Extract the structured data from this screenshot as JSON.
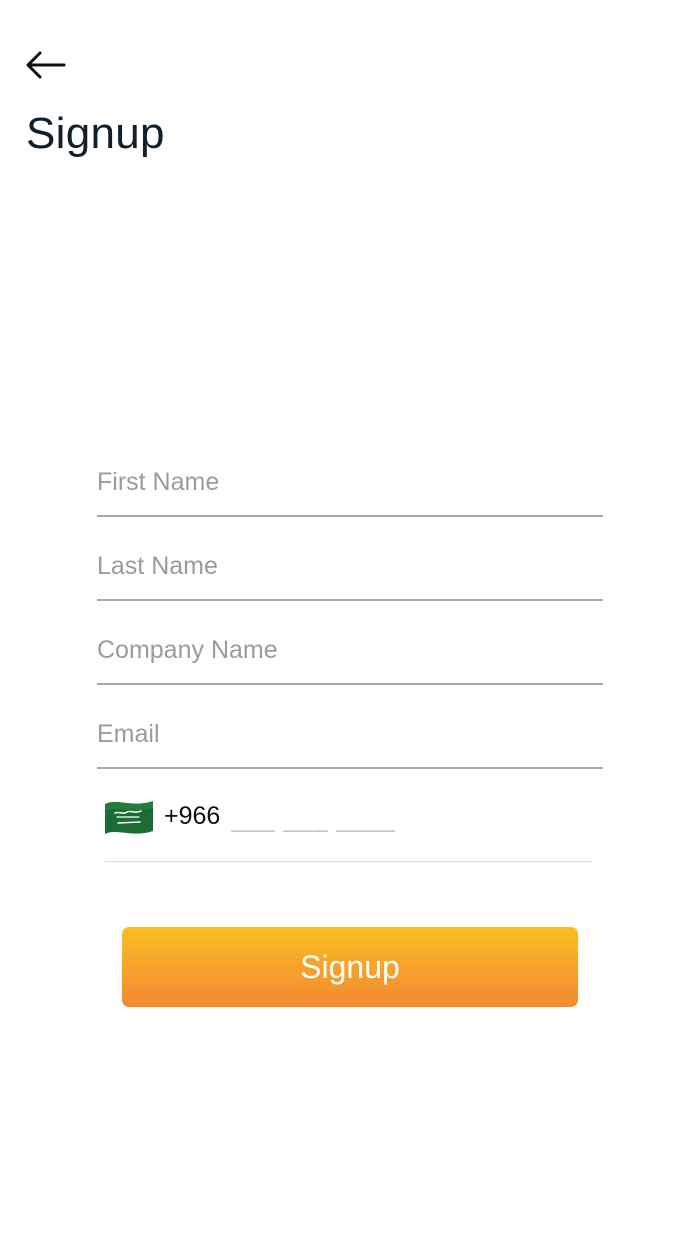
{
  "header": {
    "title": "Signup"
  },
  "form": {
    "first_name_placeholder": "First Name",
    "last_name_placeholder": "Last Name",
    "company_name_placeholder": "Company Name",
    "email_placeholder": "Email",
    "phone": {
      "country_flag_icon": "saudi-arabia-flag-icon",
      "dial_code": "+966",
      "placeholder": "___ ___ ____"
    }
  },
  "actions": {
    "signup_label": "Signup"
  },
  "colors": {
    "accent_top": "#f8c021",
    "accent_bottom": "#f38b32",
    "title": "#10202a",
    "flag_green": "#1d6b34"
  }
}
